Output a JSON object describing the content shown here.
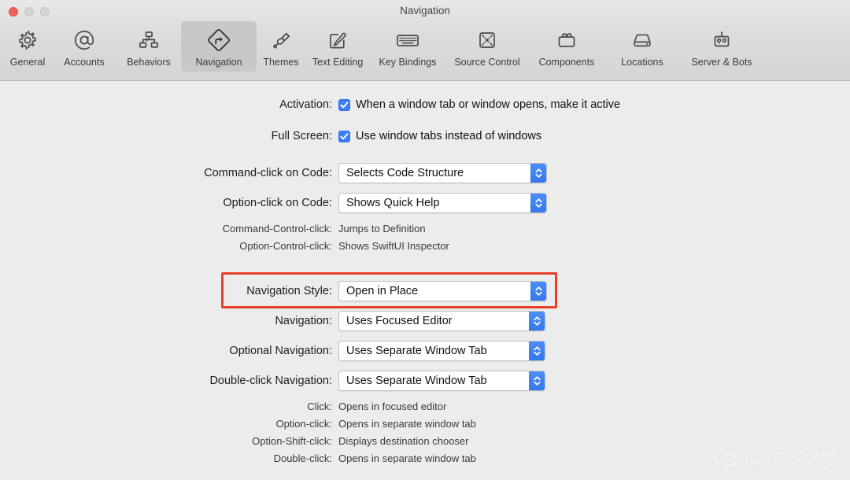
{
  "window": {
    "title": "Navigation",
    "traffic_lights": [
      {
        "name": "close",
        "color": "#f0625a"
      },
      {
        "name": "minimize",
        "color": "#d5d5d5"
      },
      {
        "name": "maximize",
        "color": "#d5d5d5"
      }
    ]
  },
  "toolbar": {
    "selected": "Navigation",
    "items": [
      {
        "label": "General",
        "icon": "gear-icon"
      },
      {
        "label": "Accounts",
        "icon": "at-sign-icon"
      },
      {
        "label": "Behaviors",
        "icon": "org-chart-icon"
      },
      {
        "label": "Navigation",
        "icon": "turn-arrow-diamond-icon"
      },
      {
        "label": "Themes",
        "icon": "paintbrush-icon"
      },
      {
        "label": "Text Editing",
        "icon": "pencil-square-icon"
      },
      {
        "label": "Key Bindings",
        "icon": "keyboard-icon"
      },
      {
        "label": "Source Control",
        "icon": "source-control-icon"
      },
      {
        "label": "Components",
        "icon": "toolbox-icon"
      },
      {
        "label": "Locations",
        "icon": "hard-drive-icon"
      },
      {
        "label": "Server & Bots",
        "icon": "robot-icon"
      }
    ]
  },
  "settings": {
    "activation": {
      "label": "Activation:",
      "checkbox_label": "When a window tab or window opens, make it active",
      "checked": true
    },
    "full_screen": {
      "label": "Full Screen:",
      "checkbox_label": "Use window tabs instead of windows",
      "checked": true
    },
    "command_click_on_code": {
      "label": "Command-click on Code:",
      "value": "Selects Code Structure"
    },
    "option_click_on_code": {
      "label": "Option-click on Code:",
      "value": "Shows Quick Help"
    },
    "command_control_click": {
      "label": "Command-Control-click:",
      "value": "Jumps to Definition"
    },
    "option_control_click": {
      "label": "Option-Control-click:",
      "value": "Shows SwiftUI Inspector"
    },
    "navigation_style": {
      "label": "Navigation Style:",
      "value": "Open in Place",
      "highlighted": true,
      "highlight_color": "#e8412a"
    },
    "navigation": {
      "label": "Navigation:",
      "value": "Uses Focused Editor"
    },
    "optional_navigation": {
      "label": "Optional Navigation:",
      "value": "Uses Separate Window Tab"
    },
    "double_click_navigation": {
      "label": "Double-click Navigation:",
      "value": "Uses Separate Window Tab"
    },
    "click": {
      "label": "Click:",
      "value": "Opens in focused editor"
    },
    "option_click": {
      "label": "Option-click:",
      "value": "Opens in separate window tab"
    },
    "option_shift_click": {
      "label": "Option-Shift-click:",
      "value": "Displays destination chooser"
    },
    "double_click": {
      "label": "Double-click:",
      "value": "Opens in separate window tab"
    }
  },
  "watermark": {
    "text": "iOS成长之路",
    "icon": "wechat-icon"
  }
}
